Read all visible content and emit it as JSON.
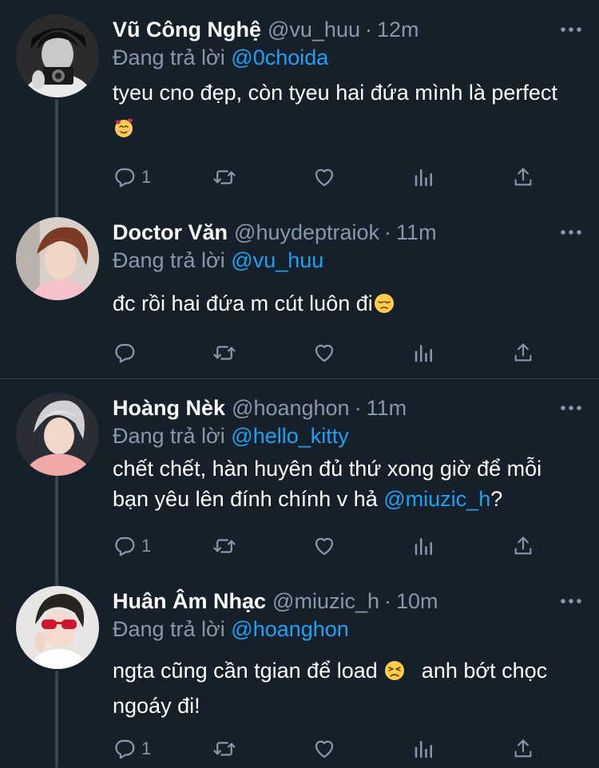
{
  "tweets": [
    {
      "name": "Vũ Công Nghệ",
      "handle": "@vu_huu",
      "time": "12m",
      "reply_prefix": "Đang trả lời",
      "reply_to": "@0choida",
      "text": "tyeu cno đẹp, còn tyeu hai đứa mình là perfect",
      "emoji": "smiling-face-with-hearts",
      "reply_count": "1"
    },
    {
      "name": "Doctor Văn",
      "handle": "@huydeptraiok",
      "time": "11m",
      "reply_prefix": "Đang trả lời",
      "reply_to": "@vu_huu",
      "text": "đc rồi hai đứa m cút luôn đi",
      "emoji": "pensive-face",
      "reply_count": ""
    },
    {
      "name": "Hoàng Nèk",
      "handle": "@hoanghon",
      "time": "11m",
      "reply_prefix": "Đang trả lời",
      "reply_to": "@hello_kitty",
      "text_before": "chết chết, hàn huyên đủ thứ xong giờ để mỗi bạn yêu lên đính chính v hả ",
      "text_mention": "@miuzic_h",
      "text_after": "?",
      "reply_count": "1"
    },
    {
      "name": "Huân Âm Nhạc",
      "handle": "@miuzic_h",
      "time": "10m",
      "reply_prefix": "Đang trả lời",
      "reply_to": "@hoanghon",
      "text_before": "ngta cũng cần tgian để load",
      "emoji": "persevering-face",
      "text_after": "anh bớt chọc ngoáy đi!",
      "reply_count": "1"
    }
  ],
  "icons": [
    "more-icon",
    "reply-icon",
    "retweet-icon",
    "like-icon",
    "analytics-icon",
    "share-icon"
  ],
  "colors": {
    "background": "#15202b",
    "muted": "#8899a6",
    "accent": "#1da1f2",
    "divider": "#38444d"
  }
}
